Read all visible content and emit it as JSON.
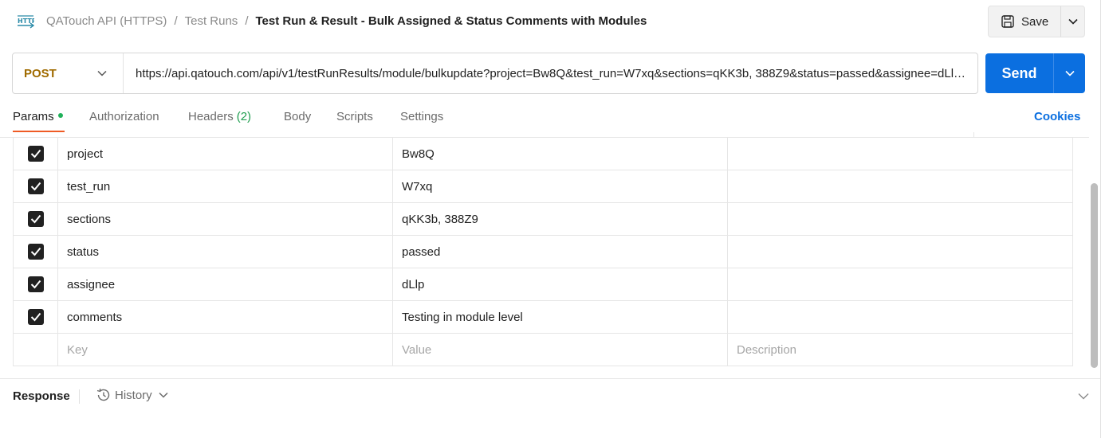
{
  "breadcrumb": {
    "collection": "QATouch API (HTTPS)",
    "folder": "Test Runs",
    "separator": "/",
    "current": "Test Run & Result - Bulk Assigned & Status Comments with Modules"
  },
  "toolbar": {
    "save_label": "Save"
  },
  "request": {
    "method": "POST",
    "url": "https://api.qatouch.com/api/v1/testRunResults/module/bulkupdate?project=Bw8Q&test_run=W7xq&sections=qKK3b, 388Z9&status=passed&assignee=dLlp&comments=Testing in module level",
    "send_label": "Send"
  },
  "tabs": [
    {
      "label": "Params",
      "active": true
    },
    {
      "label": "Authorization"
    },
    {
      "label": "Headers",
      "count": "(2)"
    },
    {
      "label": "Body"
    },
    {
      "label": "Scripts"
    },
    {
      "label": "Settings"
    }
  ],
  "cookies_label": "Cookies",
  "params": [
    {
      "key": "project",
      "value": "Bw8Q",
      "checked": true
    },
    {
      "key": "test_run",
      "value": "W7xq",
      "checked": true
    },
    {
      "key": "sections",
      "value": "qKK3b, 388Z9",
      "checked": true
    },
    {
      "key": "status",
      "value": "passed",
      "checked": true
    },
    {
      "key": "assignee",
      "value": "dLlp",
      "checked": true
    },
    {
      "key": "comments",
      "value": "Testing in module level",
      "checked": true
    }
  ],
  "placeholders": {
    "key": "Key",
    "value": "Value",
    "description": "Description"
  },
  "response": {
    "label": "Response",
    "history_label": "History"
  },
  "colors": {
    "accent": "#0b6fe0",
    "method": "#a06b00",
    "tab_underline": "#ef5b25",
    "dot": "#20b15a"
  },
  "icons": {
    "http": "http-request-icon",
    "save": "floppy-disk-icon",
    "history": "history-clock-icon",
    "chevron": "chevron-down-icon"
  }
}
